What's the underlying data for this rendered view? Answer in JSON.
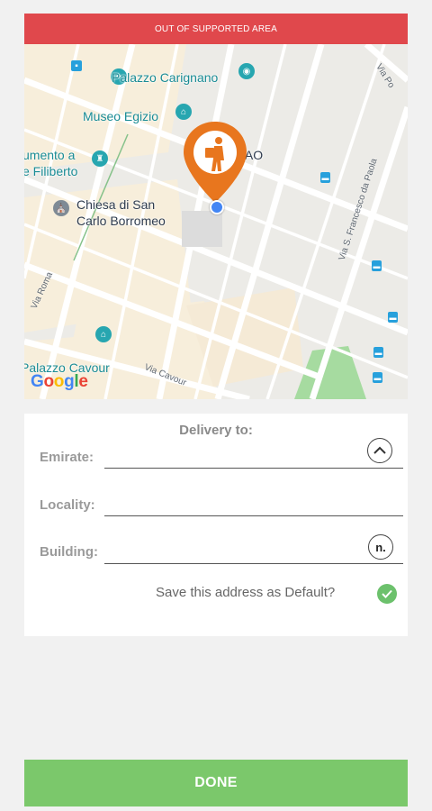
{
  "banner": {
    "text": "OUT OF SUPPORTED AREA"
  },
  "map": {
    "places": {
      "palazzo_carignano": "Palazzo Carignano",
      "museo_egizio": "Museo Egizio",
      "monumento_line1": "umento a",
      "monumento_line2": "e Filiberto",
      "miaao": "MIAAO",
      "chiesa_line1": "Chiesa di San",
      "chiesa_line2": "Carlo Borromeo",
      "palazzo_cavour": "Palazzo Cavour"
    },
    "streets": {
      "via_po": "Via Po",
      "via_roma": "Via Roma",
      "via_cavour": "Via Cavour",
      "via_s_francesco": "Via S. Francesco da Paola"
    },
    "logo": "Google"
  },
  "form": {
    "title": "Delivery to:",
    "emirate_label": "Emirate:",
    "locality_label": "Locality:",
    "building_label": "Building:",
    "building_button": "n.",
    "default_text": "Save this address as Default?"
  },
  "done_label": "DONE",
  "colors": {
    "banner": "#e0484c",
    "pin": "#e8761e",
    "done": "#7bc86b",
    "check": "#6cc16c"
  }
}
